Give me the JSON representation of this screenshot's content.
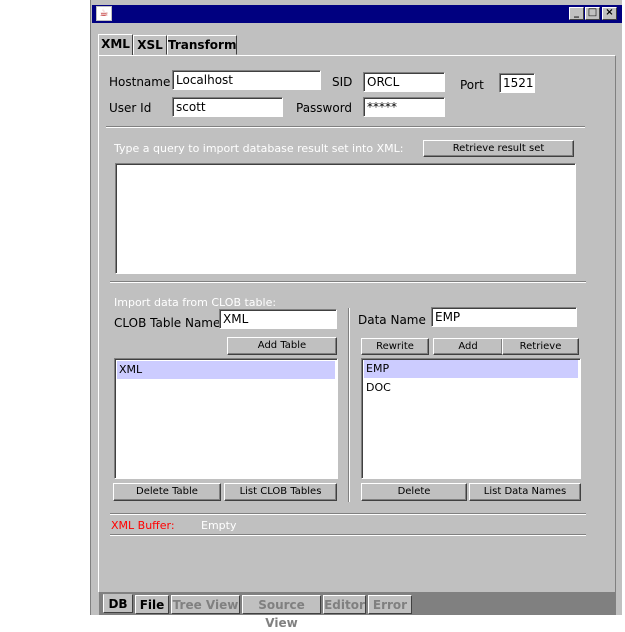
{
  "titlebar": {
    "icon": "java-cup-icon",
    "min": "_",
    "max": "□",
    "close": "×"
  },
  "tabs": [
    "XML",
    "XSL",
    "Transform"
  ],
  "conn": {
    "hostname_label": "Hostname",
    "hostname": "Localhost",
    "sid_label": "SID",
    "sid": "ORCL",
    "port_label": "Port",
    "port": "1521",
    "userid_label": "User Id",
    "userid": "scott",
    "password_label": "Password",
    "password": "*****"
  },
  "query": {
    "prompt": "Type a query to import database result set into XML:",
    "retrieve_button": "Retrieve result set"
  },
  "clob": {
    "heading": "Import data from CLOB table:",
    "table_label": "CLOB Table Name",
    "table_value": "XML",
    "add_button": "Add Table",
    "items": [
      "XML"
    ],
    "delete_button": "Delete Table",
    "list_button": "List CLOB Tables"
  },
  "data": {
    "label": "Data Name",
    "value": "EMP",
    "rewrite_button": "Rewrite",
    "add_button": "Add",
    "retrieve_button": "Retrieve",
    "items": [
      "EMP",
      "DOC"
    ],
    "delete_button": "Delete",
    "list_button": "List Data Names"
  },
  "buffer": {
    "label": "XML Buffer:",
    "value": "Empty",
    "label_color": "#ff0000"
  },
  "bottom_tabs": [
    "DB",
    "File",
    "Tree View",
    "Source View",
    "Editor",
    "Error"
  ]
}
